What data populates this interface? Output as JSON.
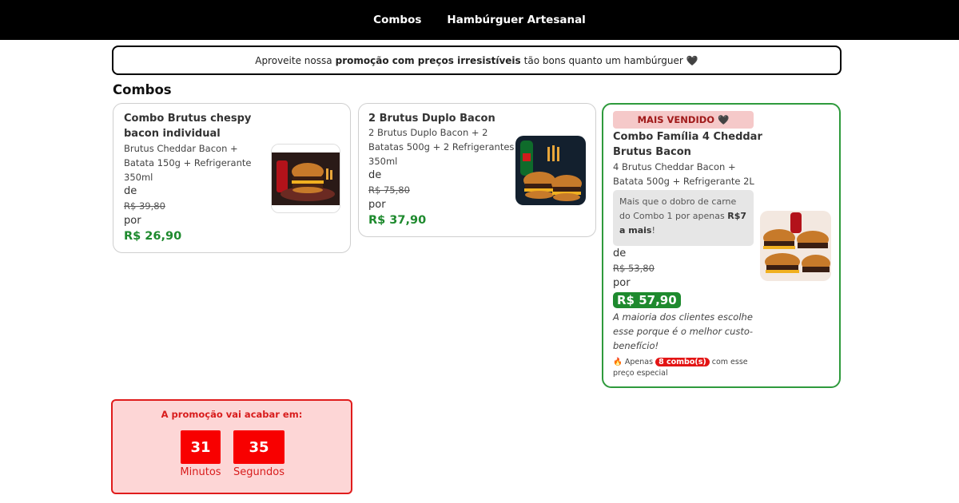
{
  "nav": {
    "items": [
      {
        "label": "Combos"
      },
      {
        "label": "Hambúrguer Artesanal"
      }
    ]
  },
  "banner": {
    "prefix": "Aproveite nossa",
    "bold": "promoção com preços irresistíveis",
    "suffix": "tão bons quanto um hambúrguer",
    "heart": "🖤"
  },
  "section": {
    "title": "Combos"
  },
  "cards": [
    {
      "title_line1": "Combo Brutus chespy",
      "title_line2": "bacon individual",
      "desc_lines": [
        "Brutus Cheddar Bacon +",
        "Batata 150g + Refrigerante",
        "350ml"
      ],
      "from_label": "de",
      "old_price": "R$ 39,80",
      "to_label": "por",
      "price": "R$ 26,90",
      "image_icon": "burger-photo-icon"
    },
    {
      "title_line1": "2 Brutus Duplo Bacon",
      "desc_lines": [
        "2 Brutus Duplo Bacon + 2",
        "Batatas 500g + 2 Refrigerantes",
        "350ml"
      ],
      "from_label": "de",
      "old_price": "R$ 75,80",
      "to_label": "por",
      "price": "R$ 37,90",
      "image_icon": "burger-combo-photo-icon"
    },
    {
      "badge": "MAIS VENDIDO",
      "badge_heart": "🖤",
      "title_line1": "Combo Família 4 Cheddar",
      "title_line2": "Brutus Bacon",
      "desc_lines": [
        "4 Brutus Cheddar Bacon +",
        "Batata 500g + Refrigerante 2L"
      ],
      "note_prefix": "Mais que o dobro de carne do Combo 1 por apenas",
      "note_bold": "R$7 a mais",
      "note_suffix": "!",
      "from_label": "de",
      "old_price": "R$ 53,80",
      "to_label": "por",
      "price": "R$ 57,90",
      "italic_note": "A maioria dos clientes escolhe esse porque é o melhor custo-benefício!",
      "scarcity_fire": "🔥",
      "scarcity_prefix": "Apenas",
      "scarcity_pill": "8 combo(s)",
      "scarcity_suffix": "com esse preço especial",
      "image_icon": "family-burgers-photo-icon"
    }
  ],
  "timer": {
    "title": "A promoção vai acabar em:",
    "minutes": "31",
    "minutes_label": "Minutos",
    "seconds": "35",
    "seconds_label": "Segundos"
  },
  "colors": {
    "accent_green": "#1e8a2e",
    "alert_red": "#f80000",
    "nav_bg": "#000000"
  }
}
